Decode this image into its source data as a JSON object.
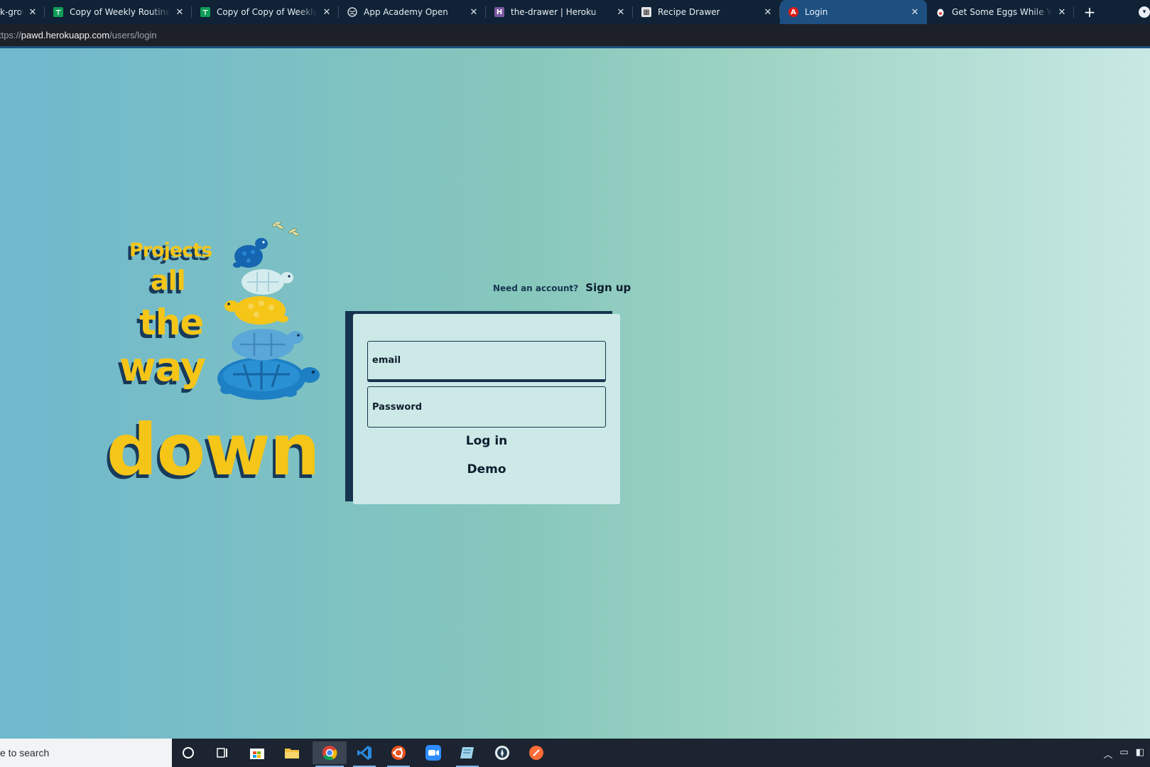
{
  "browser": {
    "tabs": [
      {
        "title": "k-group",
        "favicon": "generic-page-icon",
        "color": "#1a73e8",
        "active": false
      },
      {
        "title": "Copy of Weekly Routine Te",
        "favicon": "sheets-icon",
        "color": "#0f9d58",
        "active": false
      },
      {
        "title": "Copy of Copy of Weekly Ro",
        "favicon": "sheets-icon",
        "color": "#0f9d58",
        "active": false
      },
      {
        "title": "App Academy Open",
        "favicon": "globe-icon",
        "color": "#9aa4ae",
        "active": false
      },
      {
        "title": "the-drawer | Heroku",
        "favicon": "heroku-icon",
        "color": "#79589f",
        "active": false
      },
      {
        "title": "Recipe Drawer",
        "favicon": "recipe-icon",
        "color": "#e0e0e0",
        "active": false
      },
      {
        "title": "Login",
        "favicon": "angular-icon",
        "color": "#dd1b16",
        "active": true
      },
      {
        "title": "Get Some Eggs While You'r",
        "favicon": "egg-icon",
        "color": "#ffffff",
        "active": false
      }
    ],
    "close_glyph": "✕",
    "new_tab_glyph": "+",
    "url": {
      "scheme": "ttps://",
      "host": "pawd.herokuapp.com",
      "path": "/users/login"
    }
  },
  "page": {
    "hero": {
      "line1": "Projects",
      "line2": "all",
      "line3": "the",
      "line4": "way",
      "line5": "down"
    },
    "signup_hint": "Need an account?",
    "signup_link": "Sign up",
    "form": {
      "email_placeholder": "email",
      "password_placeholder": "Password",
      "login_label": "Log in",
      "demo_label": "Demo"
    },
    "colors": {
      "accent_yellow": "#f5c518",
      "navy": "#16344f",
      "card_bg": "#cde9e7"
    }
  },
  "taskbar": {
    "search_text": "e to search",
    "icons": [
      "cortana-icon",
      "task-view-icon",
      "store-icon",
      "file-explorer-icon",
      "chrome-icon",
      "vscode-icon",
      "ubuntu-icon",
      "zoom-icon",
      "notepad-icon",
      "mongodb-compass-icon",
      "postman-icon"
    ]
  }
}
